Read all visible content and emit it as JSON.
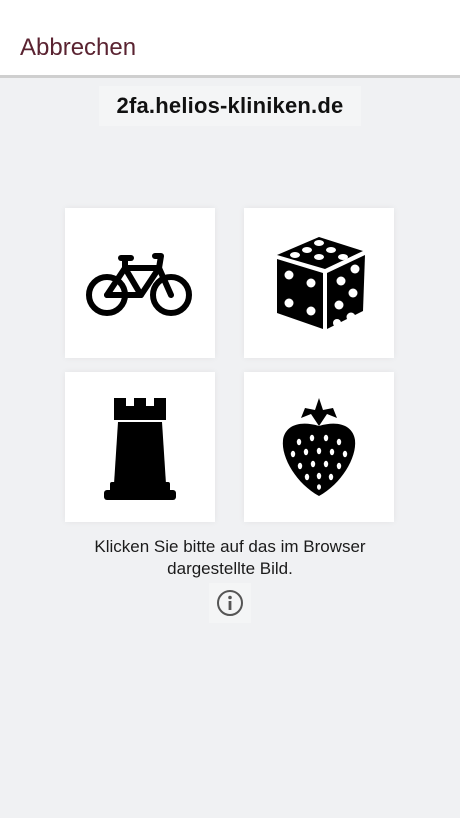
{
  "header": {
    "cancel_label": "Abbrechen"
  },
  "domain": "2fa.helios-kliniken.de",
  "tiles": [
    {
      "icon": "bicycle-icon"
    },
    {
      "icon": "dice-icon"
    },
    {
      "icon": "chess-rook-icon"
    },
    {
      "icon": "strawberry-icon"
    }
  ],
  "instruction_line1": "Klicken Sie bitte auf das im Browser",
  "instruction_line2": "dargestellte Bild.",
  "info_icon": "info-icon",
  "colors": {
    "accent": "#5a2331",
    "background": "#f0f1f3",
    "tile": "#ffffff"
  }
}
